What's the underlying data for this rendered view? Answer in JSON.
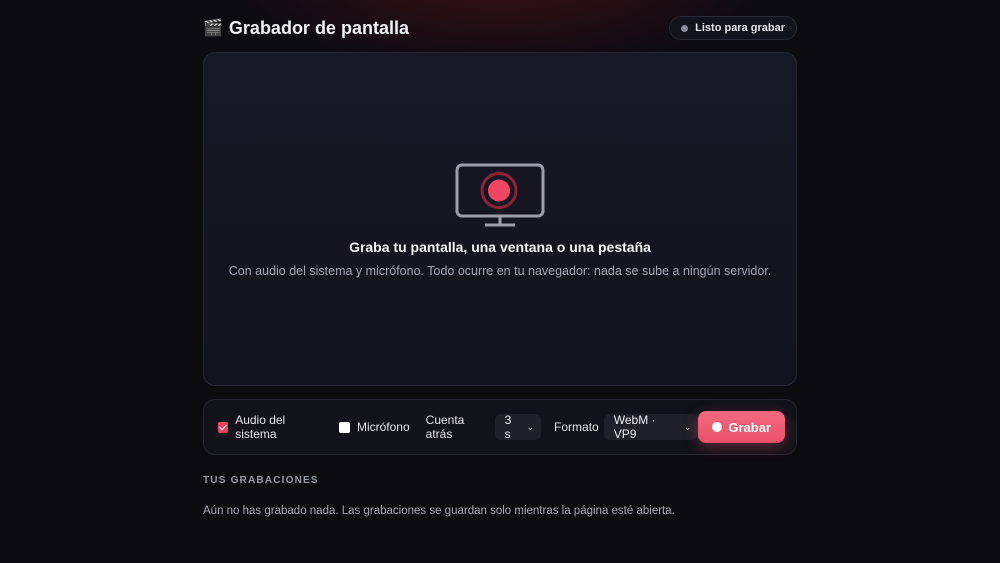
{
  "header": {
    "title_icon": "🎬",
    "title": "Grabador de pantalla",
    "status": "Listo para grabar"
  },
  "preview": {
    "icon": "monitor-record-icon",
    "title": "Graba tu pantalla, una ventana o una pestaña",
    "subtitle": "Con audio del sistema y micrófono. Todo ocurre en tu navegador: nada se sube a ningún servidor."
  },
  "controls": {
    "system_audio": {
      "label": "Audio del sistema",
      "checked": true
    },
    "microphone": {
      "label": "Micrófono",
      "checked": false
    },
    "countdown": {
      "label": "Cuenta atrás",
      "value": "3 s"
    },
    "format": {
      "label": "Formato",
      "value": "WebM · VP9"
    },
    "record_button": "Grabar"
  },
  "recordings": {
    "heading": "TUS GRABACIONES",
    "empty_text": "Aún no has grabado nada. Las grabaciones se guardan solo mientras la página esté abierta."
  },
  "colors": {
    "accent": "#ef4461",
    "background": "#0b0b10"
  }
}
